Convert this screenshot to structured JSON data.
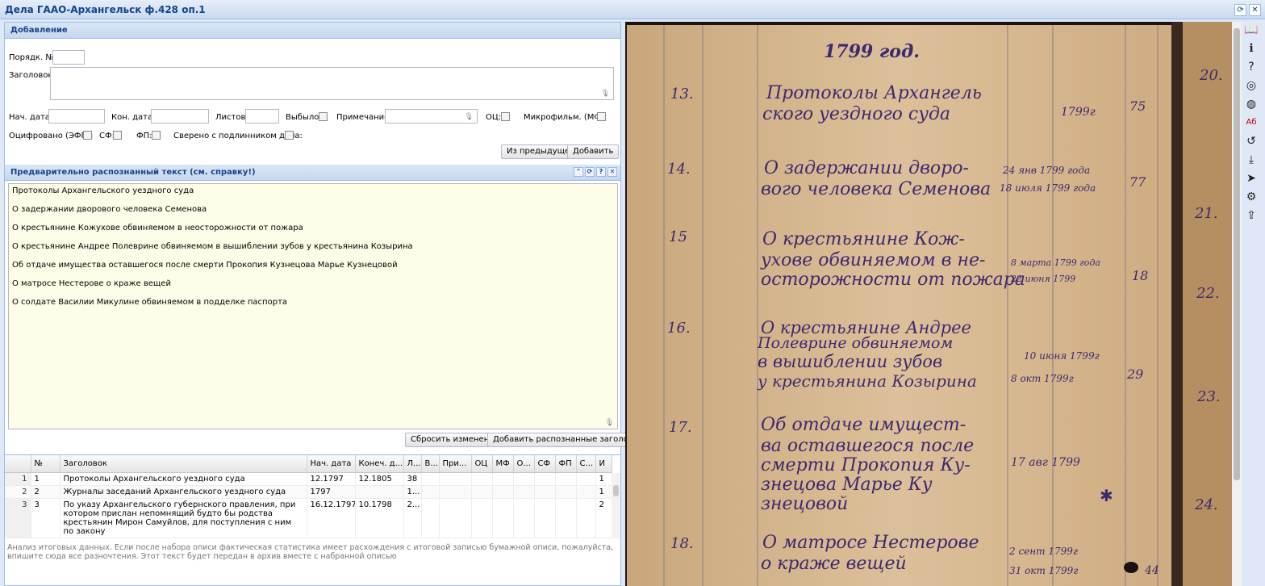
{
  "window": {
    "title": "Дела ГААО-Архангельск ф.428 оп.1"
  },
  "add_panel": {
    "title": "Добавление",
    "order_label": "Порядк. №:",
    "heading_label": "Заголовок:",
    "start_label": "Нач. дата:",
    "end_label": "Кон. дата:",
    "sheets_label": "Листов:",
    "dropped_label": "Выбыло:",
    "note_label": "Примечание:",
    "oc_label": "ОЦ:",
    "microfilm_label": "Микрофильм. (МФ):",
    "digitized_label": "Оцифровано (ЭФП):",
    "sf_label": "СФ:",
    "fp_label": "ФП:",
    "verified_label": "Сверено с подлинником дела:",
    "from_prev_btn": "Из предыдущей",
    "add_btn": "Добавить"
  },
  "recognized_panel": {
    "title": "Предварительно распознанный текст (см. справку!)",
    "lines": [
      "Протоколы Архангельского уездного суда",
      "О задержании дворового человека Семенова",
      "О крестьянине Кожухове обвиняемом в неосторожности от пожара",
      "О крестьянине Андрее Полеврине обвиняемом в вышиблении зубов у крестьянина Козырина",
      "Об отдаче имущества оставшегося после смерти Прокопия Кузнецова Марье Кузнецовой",
      "О матросе Нестерове о краже вещей",
      "О солдате Василии Микулине обвиняемом в подделке паспорта"
    ],
    "reset_btn": "Сбросить изменения",
    "add_headings_btn": "Добавить распознанные заголовки"
  },
  "grid": {
    "columns": [
      "№",
      "Заголовок",
      "Нач. дата",
      "Конеч. д...",
      "Л...",
      "В...",
      "При...",
      "ОЦ",
      "МФ",
      "О...",
      "СФ",
      "ФП",
      "С...",
      "И"
    ],
    "rows": [
      {
        "rn": "1",
        "num": "1",
        "title": "Протоколы Архангельского уездного суда",
        "start": "12.1797",
        "end": "12.1805",
        "sheets": "38",
        "last": "1"
      },
      {
        "rn": "2",
        "num": "2",
        "title": "Журналы заседаний Архангельского уездного суда",
        "start": "1797",
        "end": "",
        "sheets": "1...",
        "last": "1"
      },
      {
        "rn": "3",
        "num": "3",
        "title": "По указу Архангельского губернского правления, при котором прислан непомнящий будто бы родства крестьянин Мирон Самуйлов, для поступления с ним по закону",
        "start": "16.12.1797",
        "end": "10.1798",
        "sheets": "2...",
        "last": "2"
      }
    ]
  },
  "analysis_placeholder": "Анализ итоговых данных. Если после набора описи фактическая статистика имеет расхождения с итоговой записью бумажной описи, пожалуйста, впишите сюда все разночтения. Этот текст будет передан в архив вместе с набранной описью",
  "document": {
    "year_heading": "1799 год.",
    "entries": [
      {
        "num": "13.",
        "lines": [
          "Протоколы Архангель",
          "ского уездного суда"
        ],
        "dates": [
          "1799г"
        ],
        "sheets": "75",
        "margin": "20."
      },
      {
        "num": "14.",
        "lines": [
          "О задержании дворо-",
          "вого человека Семенова"
        ],
        "dates": [
          "24 янв 1799 года",
          "18 июля 1799 года"
        ],
        "sheets": "77",
        "margin": "21."
      },
      {
        "num": "15",
        "lines": [
          "О крестьянине Кож-",
          "ухове обвиняемом в не-",
          "осторожности от пожара"
        ],
        "dates": [
          "8 марта 1799 года",
          "22 июня 1799"
        ],
        "sheets": "18",
        "margin": "22."
      },
      {
        "num": "16.",
        "lines": [
          "О крестьянине Андрее",
          "Полеврине обвиняемом",
          "в вышиблении зубов",
          "у крестьянина Козырина"
        ],
        "dates": [
          "10 июня 1799г",
          "8 окт 1799г"
        ],
        "sheets": "29",
        "margin": "23."
      },
      {
        "num": "17.",
        "lines": [
          "Об отдаче имущест-",
          "ва оставшегося после",
          "смерти Прокопия Ку-",
          "знецова Марье Ку",
          "знецовой"
        ],
        "dates": [
          "17 авг 1799"
        ],
        "sheets": "",
        "margin": "24."
      },
      {
        "num": "18.",
        "lines": [
          "О матросе Нестерове",
          "о краже вещей"
        ],
        "dates": [
          "2 сент 1799г",
          "31 окт 1799г"
        ],
        "sheets": "44",
        "margin": ""
      }
    ]
  },
  "toolbar_icons": [
    "book-icon",
    "info-icon",
    "help-icon",
    "badge-icon",
    "globe-icon",
    "spellcheck-icon",
    "rotate-icon",
    "download-icon",
    "send-icon",
    "settings-icon",
    "export-icon"
  ]
}
